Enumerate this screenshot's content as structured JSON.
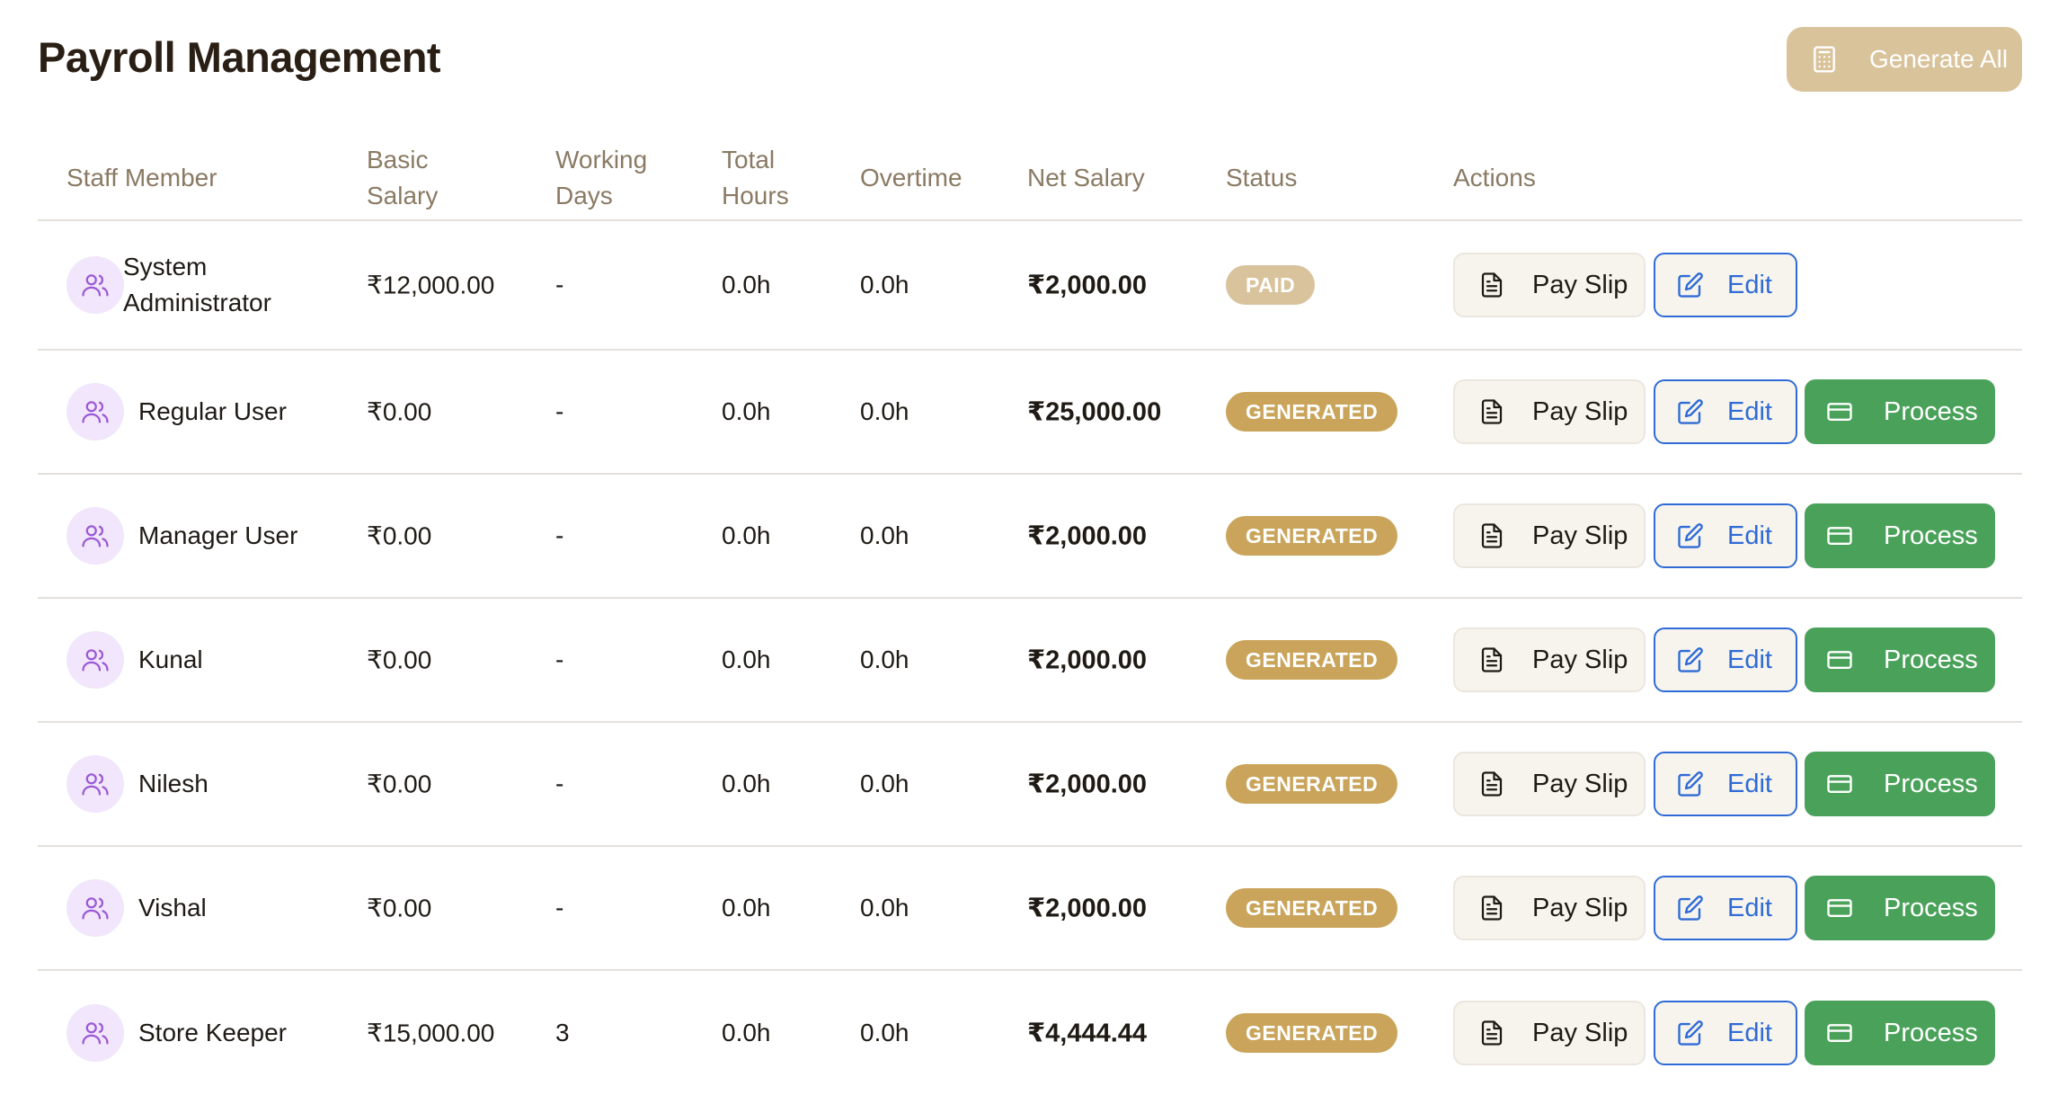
{
  "header": {
    "title": "Payroll Management",
    "generate_all_label": "Generate All"
  },
  "table": {
    "columns": {
      "staff": "Staff Member",
      "basic_salary": [
        "Basic",
        "Salary"
      ],
      "working_days": [
        "Working",
        "Days"
      ],
      "total_hours": [
        "Total",
        "Hours"
      ],
      "overtime": "Overtime",
      "net_salary": "Net Salary",
      "status": "Status",
      "actions": "Actions"
    },
    "rows": [
      {
        "name": "System Administrator",
        "basic_salary": "₹12,000.00",
        "working_days": "-",
        "total_hours": "0.0h",
        "overtime": "0.0h",
        "net_salary": "₹2,000.00",
        "status": "PAID",
        "status_color": "#d8c39c",
        "actions": [
          "Pay Slip",
          "Edit"
        ]
      },
      {
        "name": "Regular User",
        "basic_salary": "₹0.00",
        "working_days": "-",
        "total_hours": "0.0h",
        "overtime": "0.0h",
        "net_salary": "₹25,000.00",
        "status": "GENERATED",
        "status_color": "#c9a45a",
        "actions": [
          "Pay Slip",
          "Edit",
          "Process"
        ]
      },
      {
        "name": "Manager User",
        "basic_salary": "₹0.00",
        "working_days": "-",
        "total_hours": "0.0h",
        "overtime": "0.0h",
        "net_salary": "₹2,000.00",
        "status": "GENERATED",
        "status_color": "#c9a45a",
        "actions": [
          "Pay Slip",
          "Edit",
          "Process"
        ]
      },
      {
        "name": "Kunal",
        "basic_salary": "₹0.00",
        "working_days": "-",
        "total_hours": "0.0h",
        "overtime": "0.0h",
        "net_salary": "₹2,000.00",
        "status": "GENERATED",
        "status_color": "#c9a45a",
        "actions": [
          "Pay Slip",
          "Edit",
          "Process"
        ]
      },
      {
        "name": "Nilesh",
        "basic_salary": "₹0.00",
        "working_days": "-",
        "total_hours": "0.0h",
        "overtime": "0.0h",
        "net_salary": "₹2,000.00",
        "status": "GENERATED",
        "status_color": "#c9a45a",
        "actions": [
          "Pay Slip",
          "Edit",
          "Process"
        ]
      },
      {
        "name": "Vishal",
        "basic_salary": "₹0.00",
        "working_days": "-",
        "total_hours": "0.0h",
        "overtime": "0.0h",
        "net_salary": "₹2,000.00",
        "status": "GENERATED",
        "status_color": "#c9a45a",
        "actions": [
          "Pay Slip",
          "Edit",
          "Process"
        ]
      },
      {
        "name": "Store Keeper",
        "basic_salary": "₹15,000.00",
        "working_days": "3",
        "total_hours": "0.0h",
        "overtime": "0.0h",
        "net_salary": "₹4,444.44",
        "status": "GENERATED",
        "status_color": "#c9a45a",
        "actions": [
          "Pay Slip",
          "Edit",
          "Process"
        ]
      }
    ]
  },
  "icons": {
    "generate": "calculator-icon",
    "avatar": "users-icon",
    "payslip": "document-icon",
    "edit": "edit-icon",
    "process": "credit-card-icon"
  },
  "colors": {
    "accent_gold": "#c9a45a",
    "paid_badge": "#d8c39c",
    "edit_blue": "#2f6bd6",
    "process_green": "#4aa25a",
    "avatar_bg": "#f1e6fb",
    "avatar_icon": "#9b59d6"
  }
}
